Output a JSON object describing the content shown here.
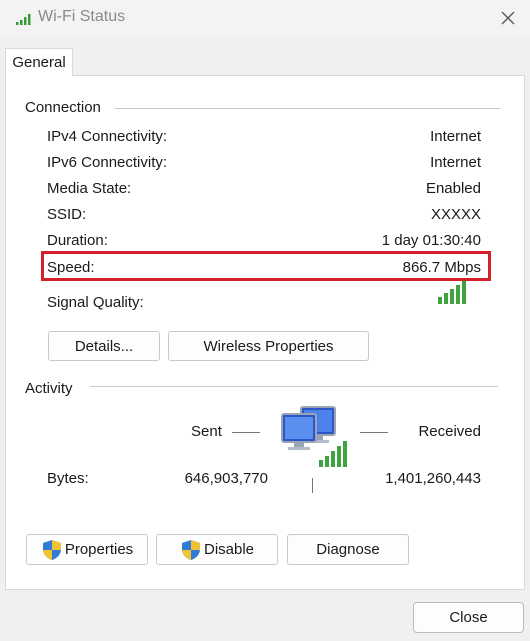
{
  "window": {
    "title": "Wi-Fi Status"
  },
  "tabs": [
    {
      "label": "General"
    }
  ],
  "connection": {
    "heading": "Connection",
    "rows": [
      {
        "label": "IPv4 Connectivity:",
        "value": "Internet"
      },
      {
        "label": "IPv6 Connectivity:",
        "value": "Internet"
      },
      {
        "label": "Media State:",
        "value": "Enabled"
      },
      {
        "label": "SSID:",
        "value": "XXXXX"
      },
      {
        "label": "Duration:",
        "value": "1 day 01:30:40"
      },
      {
        "label": "Speed:",
        "value": "866.7 Mbps"
      }
    ],
    "signal_label": "Signal Quality:",
    "signal_bars": 5,
    "highlight_color": "#d3202b",
    "details_button": "Details...",
    "wireless_button": "Wireless Properties"
  },
  "activity": {
    "heading": "Activity",
    "sent_label": "Sent",
    "received_label": "Received",
    "bytes_label": "Bytes:",
    "bytes_sent": "646,903,770",
    "bytes_received": "1,401,260,443"
  },
  "buttons": {
    "properties": "Properties",
    "disable": "Disable",
    "diagnose": "Diagnose",
    "close": "Close"
  },
  "colors": {
    "signal_green": "#3fa33f",
    "accent_red": "#d3202b"
  }
}
